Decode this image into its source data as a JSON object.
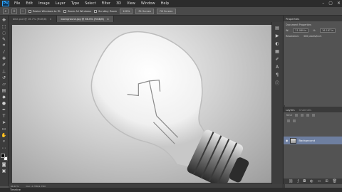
{
  "app": {
    "logo": "Ps"
  },
  "menu": [
    "File",
    "Edit",
    "Image",
    "Layer",
    "Type",
    "Select",
    "Filter",
    "3D",
    "View",
    "Window",
    "Help"
  ],
  "window_controls": [
    "–",
    "▢",
    "✕"
  ],
  "options": {
    "resize_windows": "Resize Windows to Fit",
    "zoom_all": "Zoom All Windows",
    "scrubby_zoom": "Scrubby Zoom",
    "zoom_percent": "100%",
    "fit_screen": "Fit Screen",
    "fill_screen": "Fill Screen"
  },
  "tabs": [
    {
      "label": "bike.psd @ 16.7% (RGB/8)"
    },
    {
      "label": "background.jpg @ 66.6% (RGB/8)"
    }
  ],
  "status": {
    "zoom": "66.67%",
    "doc": "Doc: 2.75M/2.75M"
  },
  "timeline": {
    "label": "Timeline"
  },
  "properties": {
    "tabs": [
      "Properties"
    ],
    "title": "Document Properties",
    "w_label": "W:",
    "w_value": "21.089 in",
    "h_label": "H:",
    "h_value": "16.187 in",
    "res_label": "Resolution:",
    "res_value": "300 pixels/inch"
  },
  "layers": {
    "tabs": [
      "Layers",
      "Channels"
    ],
    "kind": "Kind",
    "layer_name": "Background"
  },
  "colors": {
    "accent": "#31a8ff",
    "selected_layer": "#6e7fa0"
  }
}
